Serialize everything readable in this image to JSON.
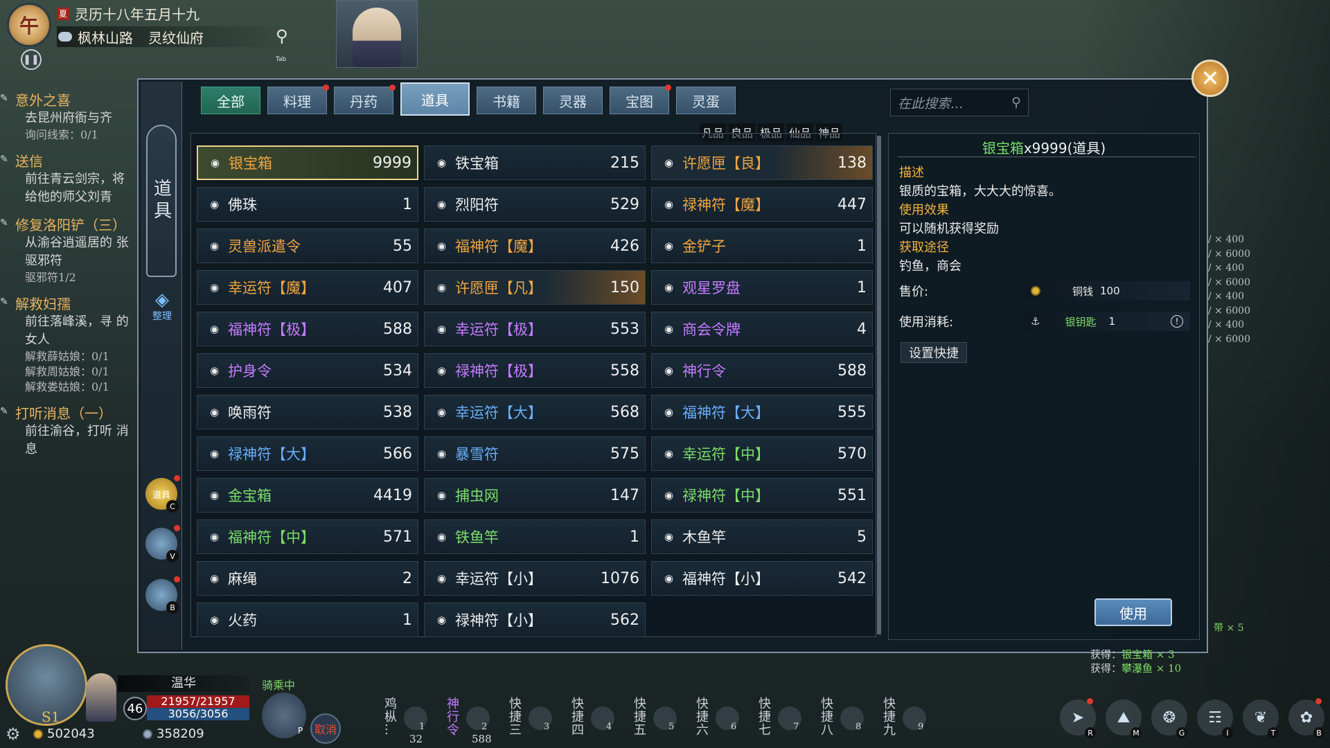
{
  "hud": {
    "clock_char": "午",
    "weather_badge": "夏",
    "date": "灵历十八年五月十九",
    "location_area": "枫林山路",
    "location_place": "灵纹仙府",
    "tab_key": "Tab"
  },
  "quests": [
    {
      "title": "意外之喜",
      "desc": "去昆州府衙与齐",
      "progress": [
        "询问线索：0/1"
      ]
    },
    {
      "title": "送信",
      "desc": "前往青云剑宗，将 给他的师父刘青",
      "progress": []
    },
    {
      "title": "修复洛阳铲（三）",
      "desc": "从渝谷逍遥居的 张驱邪符",
      "progress": [
        "驱邪符1/2"
      ]
    },
    {
      "title": "解救妇孺",
      "desc": "前往落峰溪，寻 的女人",
      "progress": [
        "解救薛姑娘：0/1",
        "解救周姑娘：0/1",
        "解救娄姑娘：0/1"
      ]
    },
    {
      "title": "打听消息（一）",
      "desc": "前往渝谷，打听 消息",
      "progress": []
    }
  ],
  "inventory": {
    "side_title": "道具",
    "sort_label": "整理",
    "side_categories": [
      {
        "label": "道具",
        "key": "C"
      },
      {
        "label": "",
        "key": "V"
      },
      {
        "label": "",
        "key": "B"
      }
    ],
    "tabs": [
      {
        "label": "全部",
        "dot": false
      },
      {
        "label": "料理",
        "dot": true
      },
      {
        "label": "丹药",
        "dot": true
      },
      {
        "label": "道具",
        "dot": false
      },
      {
        "label": "书籍",
        "dot": false
      },
      {
        "label": "灵器",
        "dot": false
      },
      {
        "label": "宝图",
        "dot": true
      },
      {
        "label": "灵蛋",
        "dot": false
      }
    ],
    "active_tab": "道具",
    "search_placeholder": "在此搜索...",
    "rarity_filters": [
      "凡品",
      "良品",
      "极品",
      "仙品",
      "神品"
    ],
    "items": [
      {
        "name": "银宝箱",
        "count": "9999",
        "color": "orange",
        "selected": true
      },
      {
        "name": "铁宝箱",
        "count": "215",
        "color": "white"
      },
      {
        "name": "许愿匣【良】",
        "count": "138",
        "color": "orange",
        "glow": true
      },
      {
        "name": "佛珠",
        "count": "1",
        "color": "white"
      },
      {
        "name": "烈阳符",
        "count": "529",
        "color": "white"
      },
      {
        "name": "禄神符【魔】",
        "count": "447",
        "color": "orange"
      },
      {
        "name": "灵兽派遣令",
        "count": "55",
        "color": "orange"
      },
      {
        "name": "福神符【魔】",
        "count": "426",
        "color": "orange"
      },
      {
        "name": "金铲子",
        "count": "1",
        "color": "orange"
      },
      {
        "name": "幸运符【魔】",
        "count": "407",
        "color": "orange"
      },
      {
        "name": "许愿匣【凡】",
        "count": "150",
        "color": "orange",
        "glow": true
      },
      {
        "name": "观星罗盘",
        "count": "1",
        "color": "purple"
      },
      {
        "name": "福神符【极】",
        "count": "588",
        "color": "purple"
      },
      {
        "name": "幸运符【极】",
        "count": "553",
        "color": "purple"
      },
      {
        "name": "商会令牌",
        "count": "4",
        "color": "purple"
      },
      {
        "name": "护身令",
        "count": "534",
        "color": "purple"
      },
      {
        "name": "禄神符【极】",
        "count": "558",
        "color": "purple"
      },
      {
        "name": "神行令",
        "count": "588",
        "color": "purple"
      },
      {
        "name": "唤雨符",
        "count": "538",
        "color": "white"
      },
      {
        "name": "幸运符【大】",
        "count": "568",
        "color": "blue"
      },
      {
        "name": "福神符【大】",
        "count": "555",
        "color": "blue"
      },
      {
        "name": "禄神符【大】",
        "count": "566",
        "color": "blue"
      },
      {
        "name": "暴雪符",
        "count": "575",
        "color": "blue"
      },
      {
        "name": "幸运符【中】",
        "count": "570",
        "color": "green"
      },
      {
        "name": "金宝箱",
        "count": "4419",
        "color": "green"
      },
      {
        "name": "捕虫网",
        "count": "147",
        "color": "green"
      },
      {
        "name": "禄神符【中】",
        "count": "551",
        "color": "green"
      },
      {
        "name": "福神符【中】",
        "count": "571",
        "color": "green"
      },
      {
        "name": "铁鱼竿",
        "count": "1",
        "color": "green"
      },
      {
        "name": "木鱼竿",
        "count": "5",
        "color": "white"
      },
      {
        "name": "麻绳",
        "count": "2",
        "color": "white"
      },
      {
        "name": "幸运符【小】",
        "count": "1076",
        "color": "white"
      },
      {
        "name": "福神符【小】",
        "count": "542",
        "color": "white"
      },
      {
        "name": "火药",
        "count": "1",
        "color": "white"
      },
      {
        "name": "禄神符【小】",
        "count": "562",
        "color": "white"
      }
    ]
  },
  "detail": {
    "name": "银宝箱",
    "suffix": "x9999(道具)",
    "desc_h": "描述",
    "desc": "银质的宝箱，大大大的惊喜。",
    "effect_h": "使用效果",
    "effect": "可以随机获得奖励",
    "source_h": "获取途径",
    "source": "钓鱼，商会",
    "price_label": "售价:",
    "price_currency": "铜钱",
    "price_value": "100",
    "cost_label": "使用消耗:",
    "cost_item": "银钥匙",
    "cost_value": "1",
    "shortcut_label": "设置快捷",
    "use_label": "使用"
  },
  "bg_log": [
    "/ × 400",
    "/ × 6000",
    "/ × 400",
    "/ × 6000",
    "/ × 400",
    "/ × 6000",
    "/ × 400",
    "/ × 6000"
  ],
  "player": {
    "name": "温华",
    "level": "46",
    "hp": "21957/21957",
    "mp": "3056/3056",
    "money1": "502043",
    "money2": "358209",
    "avatar_tag": "S1",
    "riding": "骑乘中",
    "cancel": "取消",
    "mount_key": "P"
  },
  "hotbar": [
    {
      "label": "鸡枞…",
      "num": "1",
      "count": "32",
      "active": false
    },
    {
      "label": "神行令",
      "num": "2",
      "count": "588",
      "active": true
    },
    {
      "label": "快捷三",
      "num": "3",
      "count": "",
      "active": false
    },
    {
      "label": "快捷四",
      "num": "4",
      "count": "",
      "active": false
    },
    {
      "label": "快捷五",
      "num": "5",
      "count": "",
      "active": false
    },
    {
      "label": "快捷六",
      "num": "6",
      "count": "",
      "active": false
    },
    {
      "label": "快捷七",
      "num": "7",
      "count": "",
      "active": false
    },
    {
      "label": "快捷八",
      "num": "8",
      "count": "",
      "active": false
    },
    {
      "label": "快捷九",
      "num": "9",
      "count": "",
      "active": false
    }
  ],
  "menu": [
    {
      "key": "R",
      "dot": true,
      "icon": "fish-icon"
    },
    {
      "key": "M",
      "dot": false,
      "icon": "map-icon"
    },
    {
      "key": "G",
      "dot": false,
      "icon": "compass-icon"
    },
    {
      "key": "I",
      "dot": false,
      "icon": "book-icon"
    },
    {
      "key": "T",
      "dot": false,
      "icon": "bird-icon"
    },
    {
      "key": "B",
      "dot": true,
      "icon": "pet-icon"
    }
  ],
  "obtain_log": [
    {
      "prefix": "获得：",
      "item": "银宝箱 × 3"
    },
    {
      "prefix": "获得：",
      "item": "攀瀑鱼 × 10"
    }
  ],
  "obtain_tail": "带 × 5"
}
